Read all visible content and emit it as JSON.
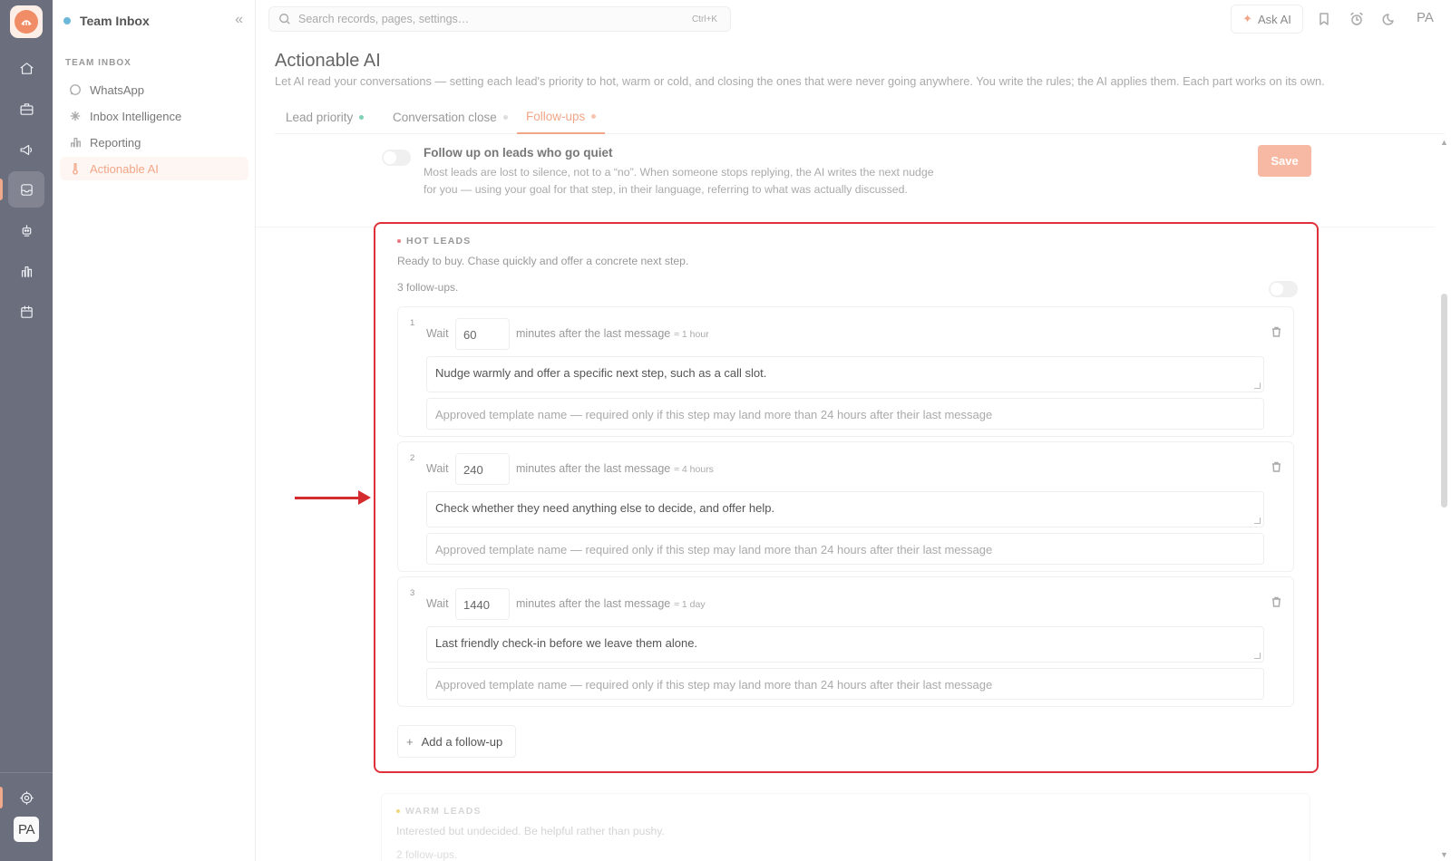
{
  "sidebar": {
    "team": "Team Inbox",
    "section": "TEAM INBOX",
    "items": [
      {
        "label": "WhatsApp",
        "icon": "whatsapp-icon"
      },
      {
        "label": "Inbox Intelligence",
        "icon": "sparkle-icon"
      },
      {
        "label": "Reporting",
        "icon": "bar-chart-icon"
      },
      {
        "label": "Actionable AI",
        "icon": "thermometer-icon",
        "active": true
      }
    ]
  },
  "rail": {
    "icons": [
      "home-icon",
      "briefcase-icon",
      "megaphone-icon",
      "inbox-icon",
      "robot-icon",
      "chart-icon",
      "calendar-icon",
      "settings-icon"
    ],
    "avatar": "PA"
  },
  "topbar": {
    "search_placeholder": "Search records, pages, settings…",
    "shortcut": "Ctrl+K",
    "ask_ai": "Ask AI",
    "avatar": "PA"
  },
  "page": {
    "title": "Actionable AI",
    "description": "Let AI read your conversations — setting each lead's priority to hot, warm or cold, and closing the ones that were never going anywhere. You write the rules; the AI applies them. Each part works on its own."
  },
  "tabs": [
    {
      "label": "Lead priority",
      "dot": "#7fd0b5"
    },
    {
      "label": "Conversation close",
      "dot": "#dddddd"
    },
    {
      "label": "Follow-ups",
      "dot": "#f7c4b0",
      "active": true
    }
  ],
  "followup_settings": {
    "title": "Follow up on leads who go quiet",
    "description": "Most leads are lost to silence, not to a “no”. When someone stops replying, the AI writes the next nudge for you — using your goal for that step, in their language, referring to what was actually discussed.",
    "save_label": "Save",
    "enabled": false
  },
  "hot_leads": {
    "heading": "HOT LEADS",
    "subtitle": "Ready to buy. Chase quickly and offer a concrete next step.",
    "count_text": "3 follow-ups.",
    "steps": [
      {
        "number": "1",
        "wait_label": "Wait",
        "minutes": "60",
        "after_label": "minutes after the last message",
        "approx": "≈ 1 hour",
        "message": "Nudge warmly and offer a specific next step, such as a call slot.",
        "template_placeholder": "Approved template name — required only if this step may land more than 24 hours after their last message"
      },
      {
        "number": "2",
        "wait_label": "Wait",
        "minutes": "240",
        "after_label": "minutes after the last message",
        "approx": "≈ 4 hours",
        "message": "Check whether they need anything else to decide, and offer help.",
        "template_placeholder": "Approved template name — required only if this step may land more than 24 hours after their last message"
      },
      {
        "number": "3",
        "wait_label": "Wait",
        "minutes": "1440",
        "after_label": "minutes after the last message",
        "approx": "≈ 1 day",
        "message": "Last friendly check-in before we leave them alone.",
        "template_placeholder": "Approved template name — required only if this step may land more than 24 hours after their last message"
      }
    ],
    "add_label": "Add a follow-up"
  },
  "warm_leads": {
    "heading": "WARM LEADS",
    "subtitle": "Interested but undecided. Be helpful rather than pushy.",
    "count_text": "2 follow-ups."
  },
  "colors": {
    "accent": "#f2a688",
    "highlight": "#e0313b",
    "rail": "#6b6e7c"
  }
}
